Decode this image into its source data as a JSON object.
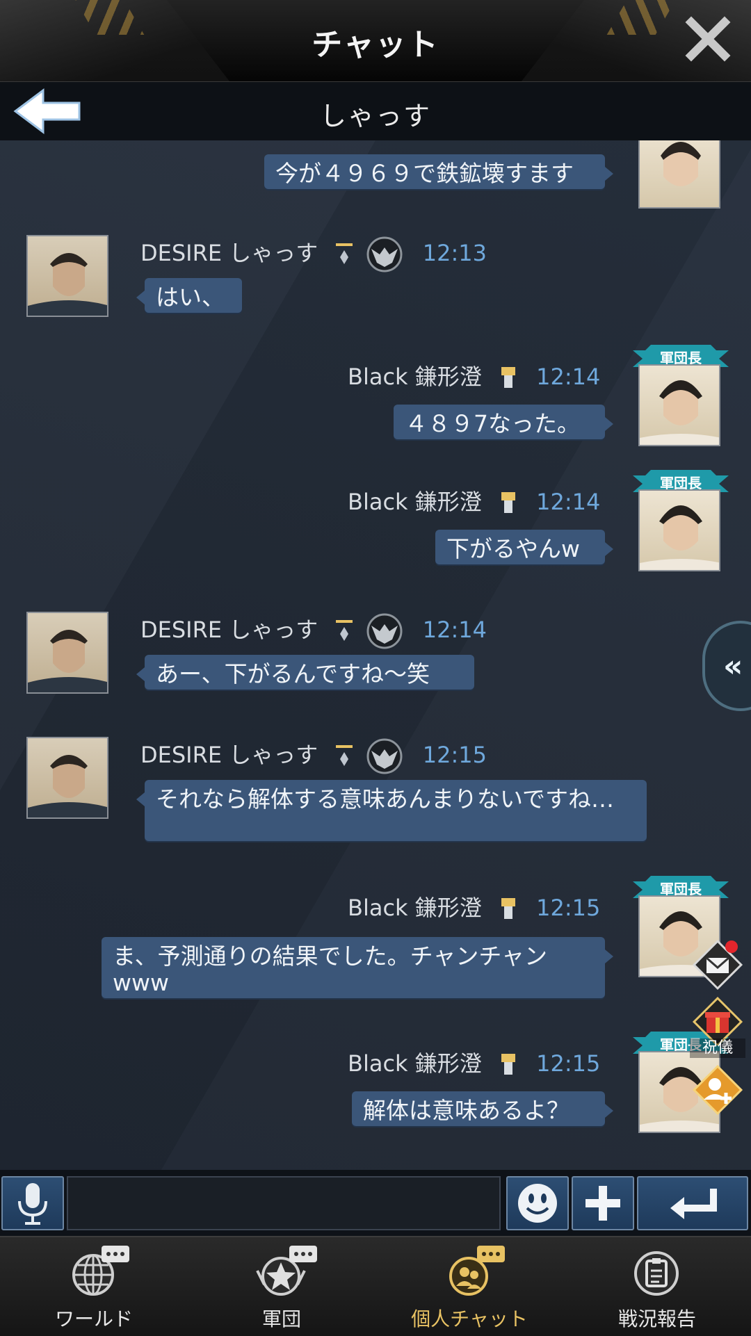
{
  "header": {
    "title": "チャット",
    "close_icon": "close-icon"
  },
  "subheader": {
    "title": "しゃっす",
    "back_icon": "back-arrow-icon"
  },
  "colors": {
    "bubble": "#3b5679",
    "time": "#6fa8dc",
    "accent_gold": "#e8c263"
  },
  "messages": [
    {
      "side": "right",
      "text": "今が４９６９で鉄鉱壊すます"
    },
    {
      "side": "left",
      "name": "DESIRE しゃっす",
      "time": "12:13",
      "text": "はい、"
    },
    {
      "side": "right",
      "name": "Black 鎌形澄",
      "rank": "軍団長",
      "time": "12:14",
      "text": "４８９7なった。"
    },
    {
      "side": "right",
      "name": "Black 鎌形澄",
      "rank": "軍団長",
      "time": "12:14",
      "text": "下がるやんw"
    },
    {
      "side": "left",
      "name": "DESIRE しゃっす",
      "time": "12:14",
      "text": "あー、下がるんですね～笑"
    },
    {
      "side": "left",
      "name": "DESIRE しゃっす",
      "time": "12:15",
      "text": "それなら解体する意味あんまりないですね…"
    },
    {
      "side": "right",
      "name": "Black 鎌形澄",
      "rank": "軍団長",
      "time": "12:15",
      "text": "ま、予測通りの結果でした。チャンチャンwww"
    },
    {
      "side": "right",
      "name": "Black 鎌形澄",
      "rank": "軍団長",
      "time": "12:15",
      "text": "解体は意味あるよ？"
    }
  ],
  "side_buttons": {
    "expand_icon": "double-chevron-left-icon",
    "gift_label": "祝儀"
  },
  "input": {
    "value": "",
    "placeholder": ""
  },
  "nav": [
    {
      "label": "ワールド",
      "icon": "globe-chat-icon",
      "active": false
    },
    {
      "label": "軍団",
      "icon": "star-emblem-chat-icon",
      "active": false
    },
    {
      "label": "個人チャット",
      "icon": "person-chat-icon",
      "active": true
    },
    {
      "label": "戦況報告",
      "icon": "clipboard-report-icon",
      "active": false
    }
  ]
}
